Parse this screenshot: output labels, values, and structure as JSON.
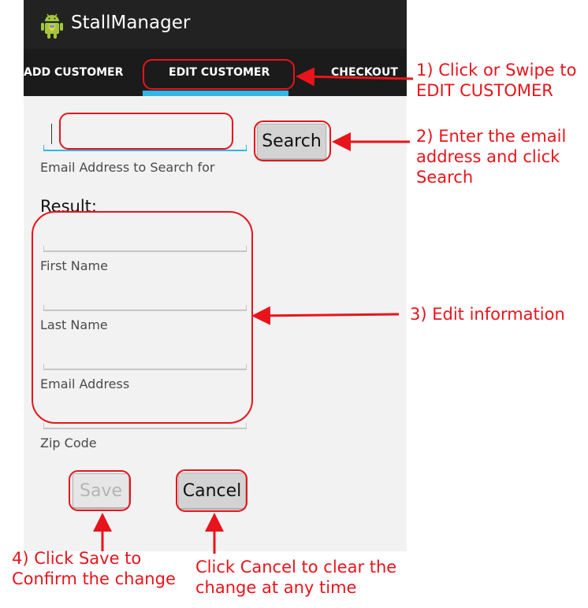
{
  "app": {
    "title": "StallManager",
    "icon": "android-robot-icon"
  },
  "tabs": [
    {
      "label": "ADD CUSTOMER",
      "selected": false
    },
    {
      "label": "EDIT CUSTOMER",
      "selected": true
    },
    {
      "label": "CHECKOUT",
      "selected": false
    }
  ],
  "search": {
    "value": "",
    "hint": "Email Address to Search for",
    "button_label": "Search"
  },
  "result": {
    "heading": "Result:",
    "fields": [
      {
        "label": "First Name",
        "value": ""
      },
      {
        "label": "Last Name",
        "value": ""
      },
      {
        "label": "Email Address",
        "value": ""
      },
      {
        "label": "Zip Code",
        "value": ""
      }
    ]
  },
  "actions": {
    "save_label": "Save",
    "save_enabled": false,
    "cancel_label": "Cancel"
  },
  "annotations": {
    "step1_line1": "1) Click or Swipe to",
    "step1_line2": "EDIT CUSTOMER",
    "step2_line1": "2) Enter the email",
    "step2_line2": "address and click",
    "step2_line3": "Search",
    "step3": "3) Edit information",
    "step4_line1": "4) Click Save to",
    "step4_line2": "Confirm the change",
    "cancel_line1": "Click Cancel to clear the",
    "cancel_line2": "change at any time"
  },
  "colors": {
    "action_bar": "#222222",
    "tab_indicator": "#33b5e5",
    "annotation_red": "#e8141b",
    "android_green": "#a4c639"
  }
}
